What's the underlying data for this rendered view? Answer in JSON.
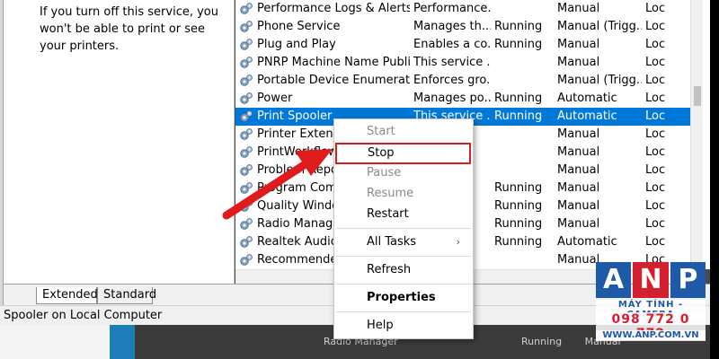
{
  "description": {
    "text": "If you turn off this service, you won't be able to print or see your printers."
  },
  "services": [
    {
      "name": "Performance Logs & Alerts",
      "desc": "Performance...",
      "status": "",
      "startup": "Manual",
      "logon": "Loc",
      "selected": false
    },
    {
      "name": "Phone Service",
      "desc": "Manages th...",
      "status": "Running",
      "startup": "Manual (Trigg...",
      "logon": "Loc",
      "selected": false
    },
    {
      "name": "Plug and Play",
      "desc": "Enables a co...",
      "status": "Running",
      "startup": "Manual",
      "logon": "Loc",
      "selected": false
    },
    {
      "name": "PNRP Machine Name Public...",
      "desc": "This service ...",
      "status": "",
      "startup": "Manual",
      "logon": "Loc",
      "selected": false
    },
    {
      "name": "Portable Device Enumerator ...",
      "desc": "Enforces gro...",
      "status": "",
      "startup": "Manual (Trigg...",
      "logon": "Loc",
      "selected": false
    },
    {
      "name": "Power",
      "desc": "Manages po...",
      "status": "Running",
      "startup": "Automatic",
      "logon": "Loc",
      "selected": false
    },
    {
      "name": "Print Spooler",
      "desc": "This service ...",
      "status": "Running",
      "startup": "Automatic",
      "logon": "Loc",
      "selected": true
    },
    {
      "name": "Printer Extensions",
      "desc": "",
      "status": "",
      "startup": "Manual",
      "logon": "Loc",
      "selected": false
    },
    {
      "name": "PrintWorkflow_c",
      "desc": "",
      "status": "",
      "startup": "Manual",
      "logon": "Loc",
      "selected": false
    },
    {
      "name": "Problem Reports",
      "desc": "",
      "status": "",
      "startup": "Manual",
      "logon": "Loc",
      "selected": false
    },
    {
      "name": "Program Compat",
      "desc": "",
      "status": "Running",
      "startup": "Manual",
      "logon": "Loc",
      "selected": false
    },
    {
      "name": "Quality Windows",
      "desc": "",
      "status": "Running",
      "startup": "Manual",
      "logon": "Loc",
      "selected": false
    },
    {
      "name": "Radio Manager",
      "desc": "",
      "status": "Running",
      "startup": "Manual",
      "logon": "Loc",
      "selected": false
    },
    {
      "name": "Realtek Audio U",
      "desc": "",
      "status": "Running",
      "startup": "Automatic",
      "logon": "Loc",
      "selected": false
    },
    {
      "name": "Recommended",
      "desc": "",
      "status": "",
      "startup": "Manual",
      "logon": "Loc",
      "selected": false
    }
  ],
  "context_menu": {
    "start": "Start",
    "stop": "Stop",
    "pause": "Pause",
    "resume": "Resume",
    "restart": "Restart",
    "all_tasks": "All Tasks",
    "all_tasks_chevron": "›",
    "refresh": "Refresh",
    "properties": "Properties",
    "help": "Help"
  },
  "tabs": {
    "extended": "Extended",
    "standard": "Standard"
  },
  "status_bar": {
    "text": "Spooler on Local Computer"
  },
  "background": {
    "radio_manager": "Radio Manager",
    "running": "Running",
    "manual": "Manual"
  },
  "watermark": {
    "letters": [
      "A",
      "N",
      "P"
    ],
    "line1": "MÁY TÍNH - CAMERA",
    "phone": "098 772 0 772",
    "web": "WWW.ANP.COM.VN"
  },
  "colors": {
    "selection": "#0078d7",
    "highlight": "#d32020",
    "arrow": "#e01b1b",
    "logo_blue": "#1f5aa8",
    "logo_red": "#d4202e"
  }
}
